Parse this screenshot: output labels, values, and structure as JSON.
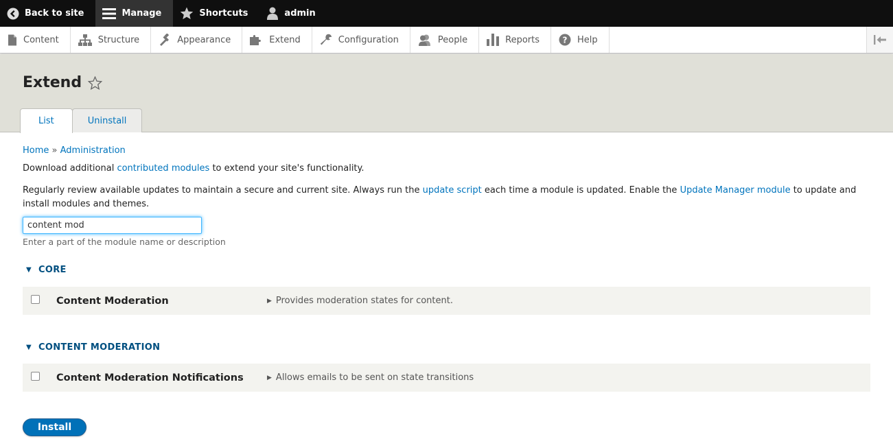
{
  "toolbar": {
    "back_label": "Back to site",
    "manage_label": "Manage",
    "shortcuts_label": "Shortcuts",
    "user_label": "admin"
  },
  "tray": {
    "items": [
      {
        "label": "Content",
        "icon": "file-icon"
      },
      {
        "label": "Structure",
        "icon": "sitemap-icon"
      },
      {
        "label": "Appearance",
        "icon": "paintbrush-icon"
      },
      {
        "label": "Extend",
        "icon": "puzzle-icon"
      },
      {
        "label": "Configuration",
        "icon": "wrench-icon"
      },
      {
        "label": "People",
        "icon": "people-icon"
      },
      {
        "label": "Reports",
        "icon": "bar-chart-icon"
      },
      {
        "label": "Help",
        "icon": "help-icon"
      }
    ]
  },
  "header": {
    "title": "Extend",
    "tabs": [
      {
        "label": "List",
        "active": true
      },
      {
        "label": "Uninstall",
        "active": false
      }
    ]
  },
  "breadcrumb": {
    "home": "Home",
    "separator": "»",
    "admin": "Administration"
  },
  "intro": {
    "p1_before": "Download additional ",
    "p1_link": "contributed modules",
    "p1_after": " to extend your site's functionality.",
    "p2_before": "Regularly review available updates to maintain a secure and current site. Always run the ",
    "p2_link1": "update script",
    "p2_mid": " each time a module is updated. Enable the ",
    "p2_link2": "Update Manager module",
    "p2_after": " to update and install modules and themes."
  },
  "filter": {
    "value": "content mod",
    "description": "Enter a part of the module name or description"
  },
  "groups": [
    {
      "title": "CORE",
      "modules": [
        {
          "name": "Content Moderation",
          "description": "Provides moderation states for content."
        }
      ]
    },
    {
      "title": "CONTENT MODERATION",
      "modules": [
        {
          "name": "Content Moderation Notifications",
          "description": "Allows emails to be sent on state transitions"
        }
      ]
    }
  ],
  "actions": {
    "install_label": "Install"
  },
  "colors": {
    "link": "#0074bd",
    "group_title": "#004f80",
    "install_button": "#0071b8",
    "header_bg": "#e0e0d8"
  }
}
